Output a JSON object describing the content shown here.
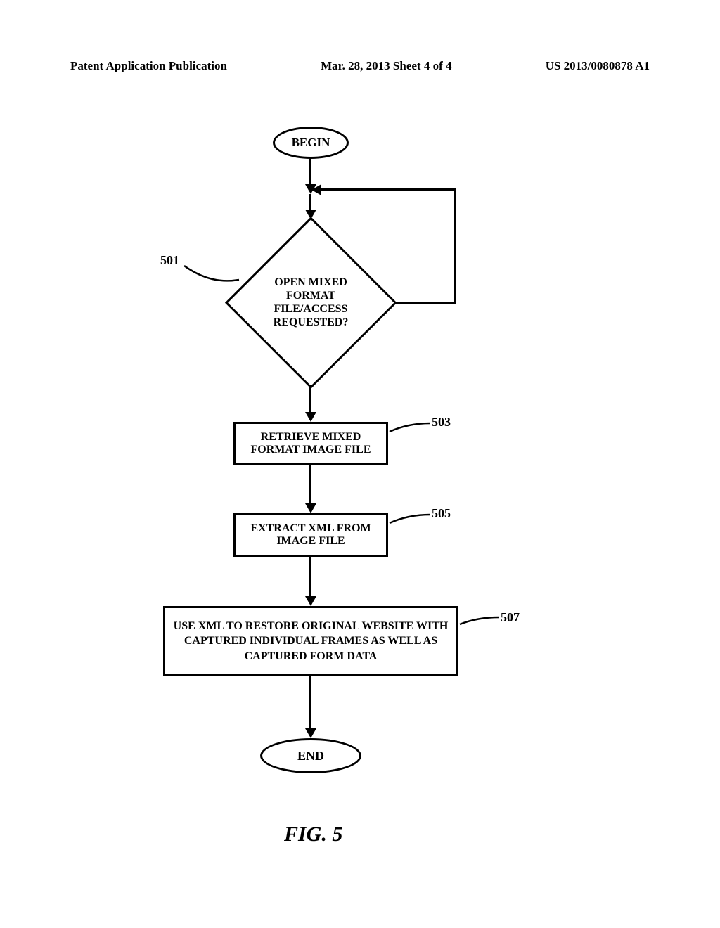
{
  "header": {
    "left": "Patent Application Publication",
    "center": "Mar. 28, 2013  Sheet 4 of 4",
    "right": "US 2013/0080878 A1"
  },
  "flowchart": {
    "begin": "BEGIN",
    "decision": "OPEN MIXED FORMAT FILE/ACCESS REQUESTED?",
    "step503": "RETRIEVE MIXED FORMAT IMAGE FILE",
    "step505": "EXTRACT XML FROM IMAGE FILE",
    "step507": "USE XML TO RESTORE ORIGINAL WEBSITE WITH CAPTURED INDIVIDUAL FRAMES AS WELL AS CAPTURED FORM DATA",
    "end": "END",
    "labels": {
      "l501": "501",
      "l503": "503",
      "l505": "505",
      "l507": "507"
    }
  },
  "figure": "FIG. 5"
}
